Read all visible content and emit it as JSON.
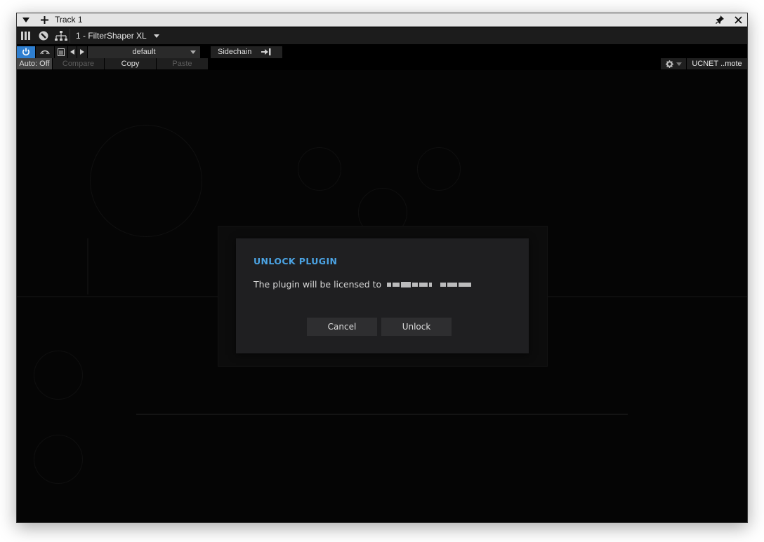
{
  "window": {
    "title": "Track 1",
    "collapse_icon": "triangle-down-icon",
    "add_icon": "plus-icon",
    "pin_icon": "pin-icon",
    "close_icon": "close-icon"
  },
  "plugin_bar": {
    "icons": [
      "mixer-icon",
      "plugin-logo-icon",
      "routing-icon"
    ],
    "plugin_name": "1 - FilterShaper XL"
  },
  "controls": {
    "power_active": true,
    "preset_name": "default",
    "sidechain_label": "Sidechain",
    "auto_label": "Auto: Off",
    "compare_label": "Compare",
    "copy_label": "Copy",
    "paste_label": "Paste",
    "remote_label": "UCNET ..mote"
  },
  "dialog": {
    "title": "UNLOCK PLUGIN",
    "message": "The plugin will be licensed to",
    "cancel_label": "Cancel",
    "unlock_label": "Unlock"
  },
  "colors": {
    "accent": "#4ba3e3",
    "power_active": "#2f7fd0"
  }
}
